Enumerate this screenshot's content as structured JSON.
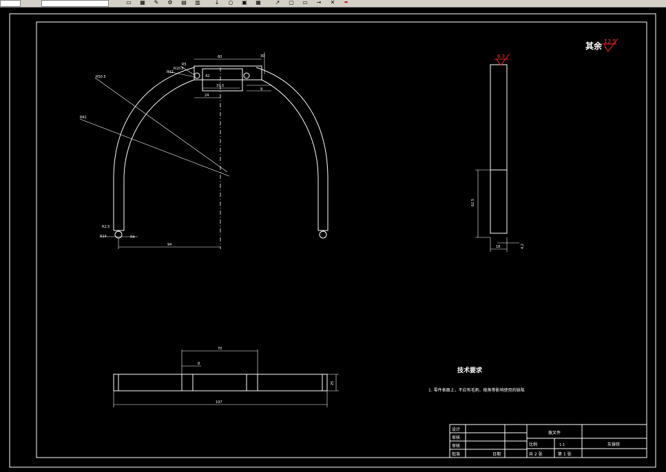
{
  "toolbar": {
    "icons": [
      "file-icon",
      "grid-icon",
      "draw-icon",
      "tool-icon",
      "layer-icon",
      "table-icon",
      "arrow-down-icon",
      "refresh-icon",
      "properties-icon",
      "calculator-icon",
      "pan-icon",
      "block-icon",
      "window-icon",
      "arrow-icon",
      "cross-icon",
      "pen-icon"
    ],
    "colors": {
      "bar": "#d4d0c8",
      "highlight": "#cc0000"
    }
  },
  "drawing": {
    "surface_note": {
      "label": "其余",
      "value": "12.5"
    },
    "side_view": {
      "roughness": "6.3",
      "height_dim": "62.5",
      "width_dim": "18",
      "bottom_dim": "4.2"
    },
    "front_view": {
      "top_width": "60",
      "top_height": "30",
      "top_offset": "9",
      "mid_dim": "37.5",
      "left_dim": "24",
      "slot": "42",
      "radii": {
        "r_outer": "R50.5",
        "r_inner": "R61",
        "r1": "R5",
        "r2": "R10.5",
        "r3": "R12",
        "r4": "R2.5",
        "r5": "R14",
        "r6": "R4"
      },
      "bottom_half_width": "94"
    },
    "bottom_view": {
      "width": "70",
      "offset": "8",
      "total": "197",
      "height": "25"
    },
    "tech_req": {
      "title": "技术要求",
      "line1": "1. 零件表面上，不应有毛刺、棱角等影响使用的缺陷"
    },
    "title_block": {
      "part_name": "拨叉件",
      "scale_label": "比例",
      "scale_value": "1:1",
      "material": "灰铸铁",
      "rows": [
        "设计",
        "审核",
        "审核",
        "批准"
      ],
      "date_label": "日期",
      "sheets": "共 2 张",
      "sheet_no": "第 1 张"
    }
  }
}
